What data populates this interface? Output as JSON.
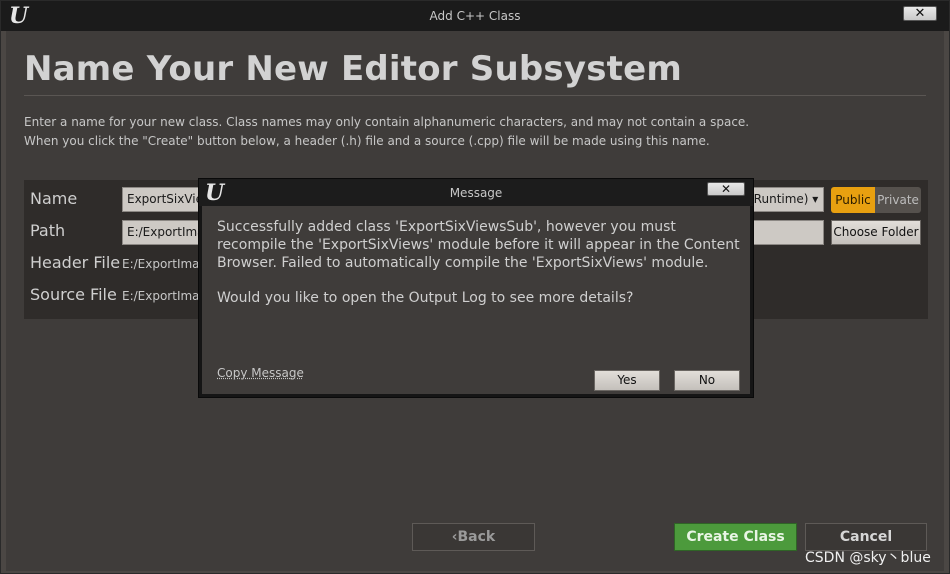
{
  "window": {
    "title": "Add C++ Class",
    "close_glyph": "✕"
  },
  "heading": "Name Your New Editor Subsystem",
  "description": [
    "Enter a name for your new class. Class names may only contain alphanumeric characters, and may not contain a space.",
    "When you click the \"Create\" button below, a header (.h) file and a source (.cpp) file will be made using this name."
  ],
  "form": {
    "name_label": "Name",
    "name_value": "ExportSixViewsSub",
    "runtime_value": "(Runtime)",
    "visibility": {
      "public": "Public",
      "private": "Private",
      "selected": "Public"
    },
    "path_label": "Path",
    "path_value": "E:/ExportImage",
    "choose_folder": "Choose Folder",
    "header_label": "Header File",
    "header_value": "E:/ExportImage",
    "source_label": "Source File",
    "source_value": "E:/ExportImage"
  },
  "buttons": {
    "back": "Back",
    "create": "Create Class",
    "cancel": "Cancel"
  },
  "dialog": {
    "title": "Message",
    "close_glyph": "✕",
    "message": "Successfully added class 'ExportSixViewsSub', however you must recompile the 'ExportSixViews' module before it will appear in the Content Browser. Failed to automatically compile the 'ExportSixViews' module.",
    "question": "Would you like to open the Output Log to see more details?",
    "copy_message": "Copy Message",
    "yes": "Yes",
    "no": "No"
  },
  "watermark": "CSDN @sky丶blue",
  "colors": {
    "accent_public": "#e8a010",
    "create_green": "#4c9a3c",
    "window_bg": "#3f3c3a"
  },
  "icons": {
    "app_logo": "unreal-logo-icon",
    "close": "close-icon",
    "dropdown": "chevron-down-icon",
    "back": "chevron-left-icon"
  }
}
